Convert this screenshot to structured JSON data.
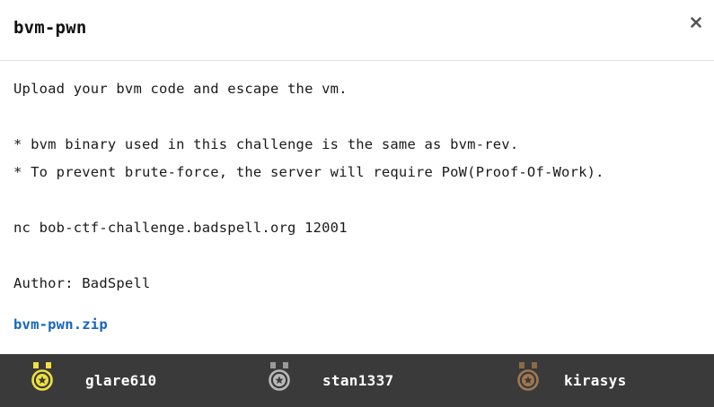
{
  "modal": {
    "title": "bvm-pwn",
    "close_icon": "close-icon"
  },
  "description": {
    "line1": "Upload your bvm code and escape the vm.",
    "line2": "* bvm binary used in this challenge is the same as bvm-rev.",
    "line3": "* To prevent brute-force, the server will require PoW(Proof-Of-Work).",
    "line4": "nc bob-ctf-challenge.badspell.org 12001",
    "line5": "Author: BadSpell"
  },
  "attachment": {
    "label": "bvm-pwn.zip",
    "color": "#1565c0"
  },
  "solvers": [
    {
      "name": "glare610",
      "medal": "gold-medal-icon",
      "color": "#f0e040"
    },
    {
      "name": "stan1337",
      "medal": "silver-medal-icon",
      "color": "#b8b8b8"
    },
    {
      "name": "kirasys",
      "medal": "bronze-medal-icon",
      "color": "#a07850"
    }
  ],
  "colors": {
    "footer_bg": "#3a3a3a",
    "text": "#1a1a1a"
  }
}
